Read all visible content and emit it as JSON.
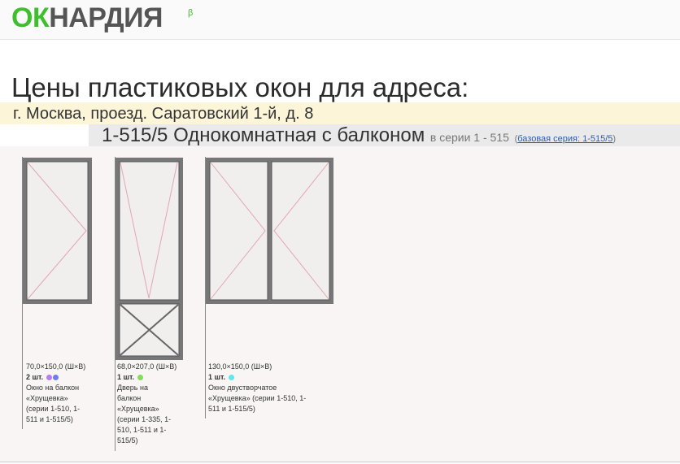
{
  "logo": {
    "ok": "ОК",
    "rest": "НАРДИЯ",
    "beta": "β"
  },
  "page": {
    "title": "Цены пластиковых окон для адреса:",
    "address": "г. Москва, проезд. Саратовский 1-й, д. 8",
    "series_title": "1-515/5 Однокомнатная с балконом",
    "series_sub": "в серии 1 - 515",
    "base_series_link": "базовая серия: 1-515/5",
    "paren_open": "(",
    "paren_close": ")"
  },
  "items": [
    {
      "size": "70,0×150,0 (Ш×В)",
      "count": "2 шт.",
      "colors": [
        "#b77cf2",
        "#6c7ff0"
      ],
      "desc_lines": [
        "Окно на балкон",
        "«Хрущевка»",
        "(серии 1-510, 1-",
        "511 и 1-515/5)"
      ]
    },
    {
      "size": "68,0×207,0 (Ш×В)",
      "count": "1 шт.",
      "colors": [
        "#7ee05a"
      ],
      "desc_lines": [
        "Дверь на",
        "балкон",
        "«Хрущевка»",
        "(серии 1-335, 1-",
        "510, 1-511 и 1-",
        "515/5)"
      ]
    },
    {
      "size": "130,0×150,0 (Ш×В)",
      "count": "1 шт.",
      "colors": [
        "#5de8f0"
      ],
      "desc_lines": [
        "Окно двустворчатое",
        "«Хрущевка» (серии 1-510, 1-",
        "511 и 1-515/5)"
      ]
    }
  ]
}
